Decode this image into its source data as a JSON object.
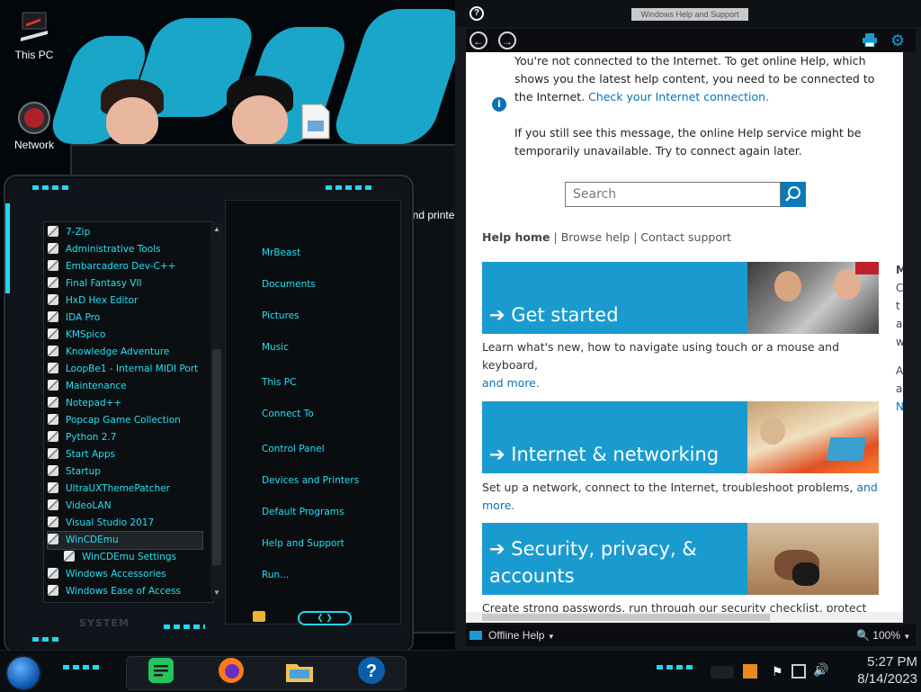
{
  "desktop": {
    "icons": [
      {
        "label": "This PC"
      },
      {
        "label": "Network"
      }
    ]
  },
  "back_window": {
    "partial_text": "and printe"
  },
  "start_menu": {
    "programs": [
      "7-Zip",
      "Administrative Tools",
      "Embarcadero Dev-C++",
      "Final Fantasy VII",
      "HxD Hex Editor",
      "IDA Pro",
      "KMSpico",
      "Knowledge Adventure",
      "LoopBe1 - Internal MIDI Port",
      "Maintenance",
      "Notepad++",
      "Popcap Game Collection",
      "Python 2.7",
      "Start Apps",
      "Startup",
      "UltraUXThemePatcher",
      "VideoLAN",
      "Visual Studio 2017",
      "WinCDEmu",
      "WinCDEmu Settings",
      "Windows Accessories",
      "Windows Ease of Access"
    ],
    "selected_index": 18,
    "sub_index": 19,
    "right_items": [
      "MrBeast",
      "Documents",
      "Pictures",
      "Music",
      "This PC",
      "Connect To",
      "Control Panel",
      "Devices and Printers",
      "Default Programs",
      "Help and Support",
      "Run..."
    ],
    "system_label": "SYSTEM"
  },
  "help": {
    "title": "Windows Help and Support",
    "message1": "You're not connected to the Internet. To get online Help, which shows you the latest help content, you need to be connected to the Internet.",
    "message1_link": "Check your Internet connection.",
    "message2": "If you still see this message, the online Help service might be temporarily unavailable. Try to connect again later.",
    "search_placeholder": "Search",
    "nav": {
      "home": "Help home",
      "sep": "|",
      "browse": "Browse help",
      "contact": "Contact support"
    },
    "tiles": [
      {
        "label": "➔ Get started",
        "desc": "Learn what's new, how to navigate using touch or a mouse and keyboard,",
        "more": "and more."
      },
      {
        "label": "➔ Internet & networking",
        "desc": "Set up a network, connect to the Internet, troubleshoot problems,",
        "more": "and more."
      },
      {
        "label": "➔ Security, privacy, &",
        "label2": "accounts",
        "desc": "Create strong passwords, run through our security checklist, protect your PC"
      }
    ],
    "side_fragments": [
      "M",
      "C",
      "t",
      "a",
      "w",
      "A",
      "a",
      "N"
    ],
    "status_left": "Offline Help",
    "status_right": "100%"
  },
  "taskbar": {
    "time": "5:27 PM",
    "date": "8/14/2023"
  },
  "colors": {
    "accent": "#22e0f4",
    "tile_blue": "#1a9bd0",
    "link": "#0b72b5"
  }
}
